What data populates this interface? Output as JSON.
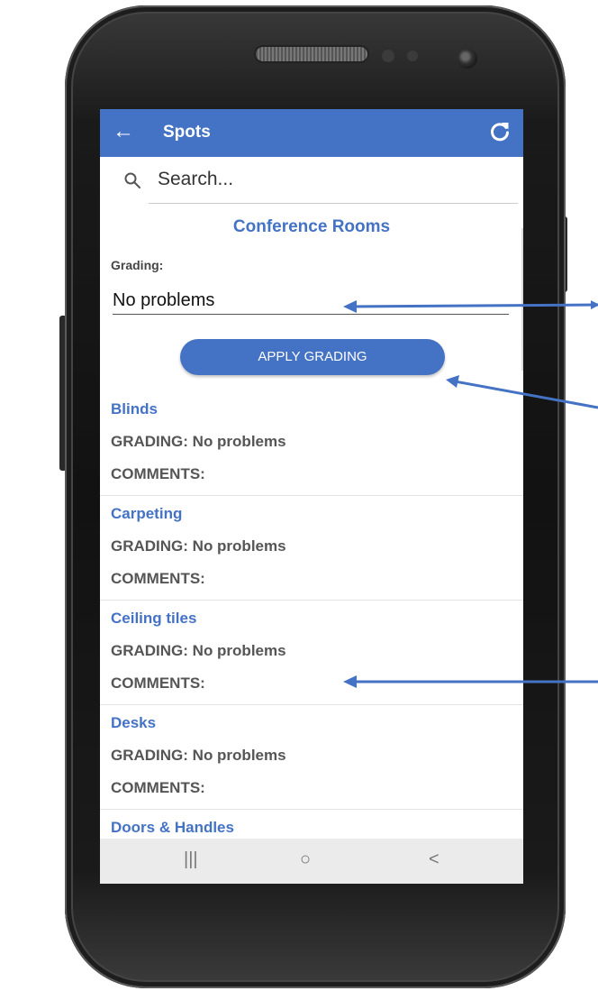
{
  "appbar": {
    "title": "Spots",
    "back_icon": "arrow-left-icon",
    "refresh_icon": "refresh-icon",
    "color": "#4472c4"
  },
  "search": {
    "placeholder": "Search...",
    "icon": "search-icon"
  },
  "section": {
    "title": "Conference Rooms"
  },
  "grading": {
    "label": "Grading:",
    "selected": "No problems"
  },
  "apply_button": {
    "label": "APPLY GRADING"
  },
  "items": [
    {
      "name": "Blinds",
      "grading": "GRADING: No problems",
      "comments": "COMMENTS:"
    },
    {
      "name": "Carpeting",
      "grading": "GRADING: No problems",
      "comments": "COMMENTS:"
    },
    {
      "name": "Ceiling tiles",
      "grading": "GRADING: No problems",
      "comments": "COMMENTS:"
    },
    {
      "name": "Desks",
      "grading": "GRADING: No problems",
      "comments": "COMMENTS:"
    },
    {
      "name": "Doors & Handles",
      "grading": "",
      "comments": ""
    }
  ],
  "navbar": {
    "recents": "|||",
    "home": "○",
    "back": "<"
  },
  "callout_color": "#4472c4"
}
